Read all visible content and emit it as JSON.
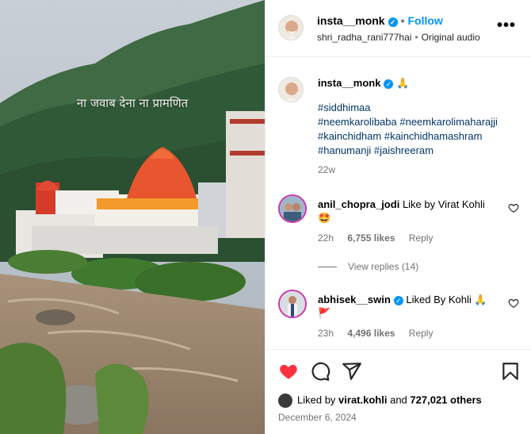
{
  "media": {
    "overlay_text": "ना जवाब देना ना प्रामणित"
  },
  "post": {
    "username": "insta__monk",
    "follow_label": "Follow",
    "separator": "•",
    "audio_user": "shri_radha_rani777hai",
    "audio_label": "Original audio",
    "more_label": "•••"
  },
  "caption": {
    "username": "insta__monk",
    "emoji": "🙏",
    "hashtags_line1": [
      "#siddhimaa"
    ],
    "hashtags_line2": [
      "#neemkarolibaba",
      "#neemkarolimaharajji"
    ],
    "hashtags_line3": [
      "#kainchidham",
      "#kainchidhamashram"
    ],
    "hashtags_line4": [
      "#hanumanji",
      "#jaishreeram"
    ],
    "time": "22w"
  },
  "comments": [
    {
      "username": "anil_chopra_jodi",
      "text": "Like by Virat Kohli",
      "emoji": "🤩",
      "time": "22h",
      "likes": "6,755 likes",
      "reply_label": "Reply"
    },
    {
      "username": "abhisek__swin",
      "text": "Liked By Kohli 🙏",
      "emoji": "🚩",
      "time": "23h",
      "likes": "4,496 likes",
      "reply_label": "Reply"
    }
  ],
  "view_replies": "View replies (14)",
  "likes_summary": {
    "prefix": "Liked by",
    "user": "virat.kohli",
    "joiner": "and",
    "others": "727,021 others"
  },
  "date": "December 6, 2024",
  "colors": {
    "accent": "#0095f6",
    "like_red": "#ff3040",
    "hashtag": "#00376b",
    "muted": "#737373"
  }
}
